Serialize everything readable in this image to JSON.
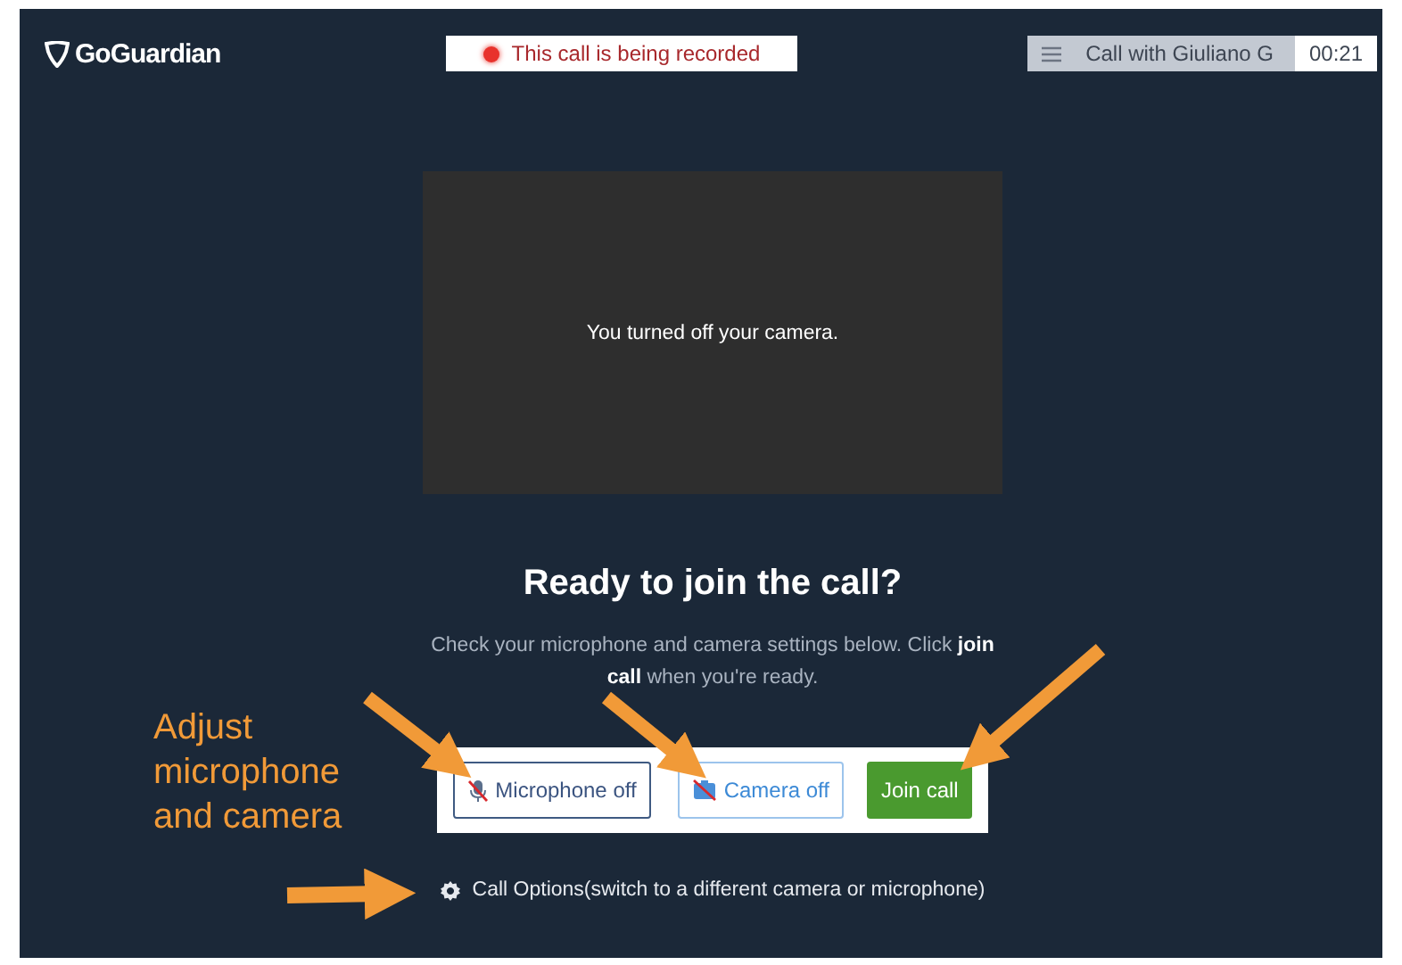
{
  "header": {
    "logo": "GoGuardian",
    "recording_notice": "This call is being recorded",
    "call_title": "Call with Giuliano G",
    "timer": "00:21"
  },
  "video": {
    "camera_on": false,
    "message": "You turned off your camera."
  },
  "heading": "Ready to join the call?",
  "instructions": "Check your microphone and camera settings below. Click **join call** when you're ready.",
  "controls": [
    {
      "kind": "microphone",
      "label": "Microphone off",
      "on": false
    },
    {
      "kind": "camera",
      "label": "Camera off",
      "on": false
    },
    {
      "kind": "join",
      "label": "Join call"
    }
  ],
  "call_options": "Call Options(switch to a different camera or microphone)",
  "annotation": "Adjust microphone and camera"
}
